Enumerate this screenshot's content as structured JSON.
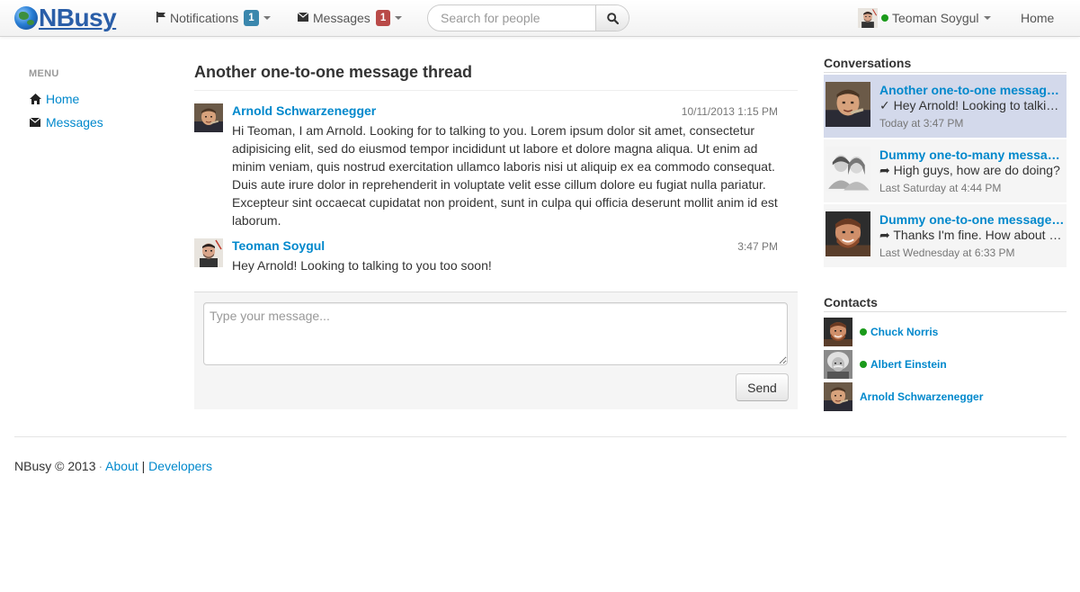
{
  "brand": {
    "name": "NBusy"
  },
  "navbar": {
    "notifications": {
      "label": "Notifications",
      "count": "1"
    },
    "messages": {
      "label": "Messages",
      "count": "1"
    },
    "search": {
      "placeholder": "Search for people"
    },
    "user": {
      "name": "Teoman Soygul"
    },
    "home": "Home"
  },
  "sidebar": {
    "header": "MENU",
    "items": [
      {
        "label": "Home",
        "icon": "home-icon"
      },
      {
        "label": "Messages",
        "icon": "envelope-icon"
      }
    ]
  },
  "thread": {
    "title": "Another one-to-one message thread",
    "messages": [
      {
        "author": "Arnold Schwarzenegger",
        "time": "10/11/2013 1:15 PM",
        "body": "Hi Teoman, I am Arnold. Looking for to talking to you. Lorem ipsum dolor sit amet, consectetur adipisicing elit, sed do eiusmod tempor incididunt ut labore et dolore magna aliqua. Ut enim ad minim veniam, quis nostrud exercitation ullamco laboris nisi ut aliquip ex ea commodo consequat. Duis aute irure dolor in reprehenderit in voluptate velit esse cillum dolore eu fugiat nulla pariatur. Excepteur sint occaecat cupidatat non proident, sunt in culpa qui officia deserunt mollit anim id est laborum."
      },
      {
        "author": "Teoman Soygul",
        "time": "3:47 PM",
        "body": "Hey Arnold! Looking to talking to you too soon!"
      }
    ],
    "composer": {
      "placeholder": "Type your message...",
      "send": "Send"
    }
  },
  "conversations": {
    "title": "Conversations",
    "items": [
      {
        "title": "Another one-to-one message thread",
        "prefix": "✓",
        "snippet": "Hey Arnold! Looking to talking to you too soon!",
        "time": "Today at 3:47 PM",
        "active": true
      },
      {
        "title": "Dummy one-to-many message thread",
        "prefix": "➦",
        "snippet": "High guys, how are do doing?",
        "time": "Last Saturday at 4:44 PM",
        "active": false
      },
      {
        "title": "Dummy one-to-one message thread",
        "prefix": "➦",
        "snippet": "Thanks I'm fine. How about you?",
        "time": "Last Wednesday at 6:33 PM",
        "active": false
      }
    ]
  },
  "contacts": {
    "title": "Contacts",
    "items": [
      {
        "name": "Chuck Norris",
        "online": true
      },
      {
        "name": "Albert Einstein",
        "online": true
      },
      {
        "name": "Arnold Schwarzenegger",
        "online": false
      }
    ]
  },
  "footer": {
    "copyright": "NBusy © 2013",
    "dot": "·",
    "about": "About",
    "pipe": "|",
    "developers": "Developers"
  },
  "colors": {
    "link": "#0088cc",
    "badge_info": "#3a87ad",
    "badge_important": "#b94a48",
    "online": "#1a9a1a",
    "active_conversation": "#d3d9eb"
  }
}
